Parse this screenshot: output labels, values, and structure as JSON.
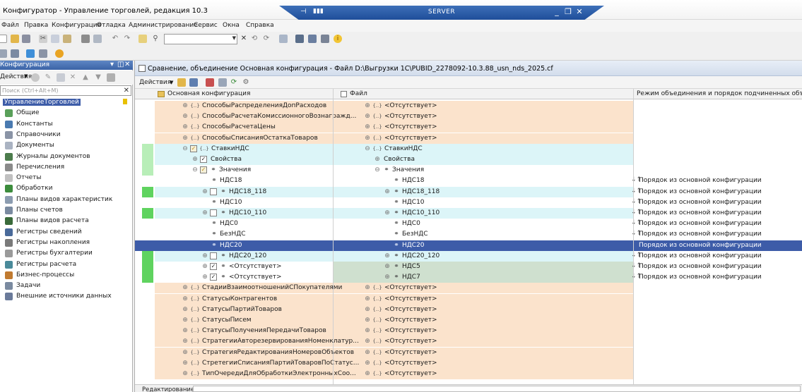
{
  "window": {
    "title": "Конфигуратор - Управление торговлей, редакция 10.3",
    "rdp_label": "SERVER"
  },
  "menu": [
    "Файл",
    "Правка",
    "Конфигурация",
    "Отладка",
    "Администрирование",
    "Сервис",
    "Окна",
    "Справка"
  ],
  "left_panel": {
    "title": "Конфигурация",
    "actions_label": "Действия",
    "search_placeholder": "Поиск (Ctrl+Alt+M)",
    "items": [
      {
        "label": "УправлениеТорговлей",
        "icon": "config-root-icon",
        "selected": true
      },
      {
        "label": "Общие",
        "icon": "common-icon"
      },
      {
        "label": "Константы",
        "icon": "constants-icon"
      },
      {
        "label": "Справочники",
        "icon": "catalogs-icon"
      },
      {
        "label": "Документы",
        "icon": "documents-icon"
      },
      {
        "label": "Журналы документов",
        "icon": "journals-icon"
      },
      {
        "label": "Перечисления",
        "icon": "enums-icon"
      },
      {
        "label": "Отчеты",
        "icon": "reports-icon"
      },
      {
        "label": "Обработки",
        "icon": "processing-icon"
      },
      {
        "label": "Планы видов характеристик",
        "icon": "chart-of-char-icon"
      },
      {
        "label": "Планы счетов",
        "icon": "chart-of-accounts-icon"
      },
      {
        "label": "Планы видов расчета",
        "icon": "chart-of-calc-icon"
      },
      {
        "label": "Регистры сведений",
        "icon": "info-register-icon"
      },
      {
        "label": "Регистры накопления",
        "icon": "accum-register-icon"
      },
      {
        "label": "Регистры бухгалтерии",
        "icon": "acc-register-icon"
      },
      {
        "label": "Регистры расчета",
        "icon": "calc-register-icon"
      },
      {
        "label": "Бизнес-процессы",
        "icon": "business-process-icon"
      },
      {
        "label": "Задачи",
        "icon": "tasks-icon"
      },
      {
        "label": "Внешние источники данных",
        "icon": "external-sources-icon"
      }
    ]
  },
  "compare": {
    "title": "Сравнение, объединение Основная конфигурация - Файл D:\\Выгрузки 1С\\PUBID_2278092-10.3.88_usn_nds_2025.cf",
    "actions_label": "Действия",
    "columns": {
      "main": "Основная конфигурация",
      "file": "Файл",
      "mode": "Режим объединения и порядок подчиненных объектов"
    },
    "status_label": "Редактирование:",
    "colors": {
      "orange_bg": "#fbe3cc",
      "cyan_bg": "#dcf5f8",
      "gray_green_bg": "#cfe0cf",
      "selected_bg": "#3d5ca8",
      "marker_green": "#5fd35f",
      "marker_light": "#b8eeb8"
    },
    "rows": [
      {
        "main_label": "СпособыРаспределенияДопРасходов",
        "main_indent": 1,
        "main_pm": "+",
        "main_icon": "enum",
        "main_cb": "",
        "file_label": "<Отсутствует>",
        "file_indent": 1,
        "file_pm": "+",
        "file_icon": "enum",
        "bg": "orange",
        "marker": "",
        "order": ""
      },
      {
        "main_label": "СпособыРасчетаКомиссионногоВознагражд...",
        "main_indent": 1,
        "main_pm": "+",
        "main_icon": "enum",
        "main_cb": "",
        "file_label": "<Отсутствует>",
        "file_indent": 1,
        "file_pm": "+",
        "file_icon": "enum",
        "bg": "orange",
        "marker": "",
        "order": ""
      },
      {
        "main_label": "СпособыРасчетаЦены",
        "main_indent": 1,
        "main_pm": "+",
        "main_icon": "enum",
        "main_cb": "",
        "file_label": "<Отсутствует>",
        "file_indent": 1,
        "file_pm": "+",
        "file_icon": "enum",
        "bg": "orange",
        "marker": "",
        "order": ""
      },
      {
        "main_label": "СпособыСписанияОстаткаТоваров",
        "main_indent": 1,
        "main_pm": "+",
        "main_icon": "enum",
        "main_cb": "",
        "file_label": "<Отсутствует>",
        "file_indent": 1,
        "file_pm": "+",
        "file_icon": "enum",
        "bg": "orange",
        "marker": "",
        "order": ""
      },
      {
        "main_label": "СтавкиНДС",
        "main_indent": 1,
        "main_pm": "-",
        "main_icon": "enum",
        "main_cb": "partial",
        "file_label": "СтавкиНДС",
        "file_indent": 1,
        "file_pm": "-",
        "file_icon": "enum",
        "bg": "cyan",
        "marker": "light",
        "order": ""
      },
      {
        "main_label": "Свойства",
        "main_indent": 2,
        "main_pm": "+",
        "main_icon": "",
        "main_cb": "checked",
        "file_label": "Свойства",
        "file_indent": 2,
        "file_pm": "+",
        "file_icon": "",
        "bg": "cyan",
        "marker": "light",
        "order": ""
      },
      {
        "main_label": "Значения",
        "main_indent": 2,
        "main_pm": "-",
        "main_icon": "value",
        "main_cb": "partial",
        "file_label": "Значения",
        "file_indent": 2,
        "file_pm": "-",
        "file_icon": "value",
        "bg": "white",
        "marker": "light",
        "order": ""
      },
      {
        "main_label": "НДС18",
        "main_indent": 3,
        "main_pm": "",
        "main_icon": "value",
        "main_cb": "",
        "file_label": "НДС18",
        "file_indent": 3,
        "file_pm": "",
        "file_icon": "value",
        "bg": "white",
        "marker": "",
        "order": "Порядок из основной конфигурации"
      },
      {
        "main_label": "НДС18_118",
        "main_indent": 3,
        "main_pm": "+",
        "main_icon": "value",
        "main_cb": "empty",
        "file_label": "НДС18_118",
        "file_indent": 3,
        "file_pm": "+",
        "file_icon": "value",
        "bg": "cyan",
        "marker": "green",
        "order": "Порядок из основной конфигурации"
      },
      {
        "main_label": "НДС10",
        "main_indent": 3,
        "main_pm": "",
        "main_icon": "value",
        "main_cb": "",
        "file_label": "НДС10",
        "file_indent": 3,
        "file_pm": "",
        "file_icon": "value",
        "bg": "white",
        "marker": "",
        "order": "Порядок из основной конфигурации"
      },
      {
        "main_label": "НДС10_110",
        "main_indent": 3,
        "main_pm": "+",
        "main_icon": "value",
        "main_cb": "empty",
        "file_label": "НДС10_110",
        "file_indent": 3,
        "file_pm": "+",
        "file_icon": "value",
        "bg": "cyan",
        "marker": "green",
        "order": "Порядок из основной конфигурации"
      },
      {
        "main_label": "НДС0",
        "main_indent": 3,
        "main_pm": "",
        "main_icon": "value",
        "main_cb": "",
        "file_label": "НДС0",
        "file_indent": 3,
        "file_pm": "",
        "file_icon": "value",
        "bg": "white",
        "marker": "",
        "order": "Порядок из основной конфигурации"
      },
      {
        "main_label": "БезНДС",
        "main_indent": 3,
        "main_pm": "",
        "main_icon": "value",
        "main_cb": "",
        "file_label": "БезНДС",
        "file_indent": 3,
        "file_pm": "",
        "file_icon": "value",
        "bg": "white",
        "marker": "",
        "order": "Порядок из основной конфигурации"
      },
      {
        "main_label": "НДС20",
        "main_indent": 3,
        "main_pm": "",
        "main_icon": "value",
        "main_cb": "",
        "file_label": "НДС20",
        "file_indent": 3,
        "file_pm": "",
        "file_icon": "value",
        "bg": "selected",
        "marker": "",
        "order": "Порядок из основной конфигурации"
      },
      {
        "main_label": "НДС20_120",
        "main_indent": 3,
        "main_pm": "+",
        "main_icon": "value",
        "main_cb": "empty",
        "file_label": "НДС20_120",
        "file_indent": 3,
        "file_pm": "+",
        "file_icon": "value",
        "bg": "cyan",
        "marker": "green",
        "order": "Порядок из основной конфигурации"
      },
      {
        "main_label": "<Отсутствует>",
        "main_indent": 3,
        "main_pm": "+",
        "main_icon": "value",
        "main_cb": "checked",
        "file_label": "НДС5",
        "file_indent": 3,
        "file_pm": "+",
        "file_icon": "value",
        "bg": "graygreen",
        "marker": "green",
        "order": "Порядок из основной конфигурации"
      },
      {
        "main_label": "<Отсутствует>",
        "main_indent": 3,
        "main_pm": "+",
        "main_icon": "value",
        "main_cb": "checked",
        "file_label": "НДС7",
        "file_indent": 3,
        "file_pm": "+",
        "file_icon": "value",
        "bg": "graygreen",
        "marker": "green",
        "order": "Порядок из основной конфигурации"
      },
      {
        "main_label": "СтадииВзаимоотношенийСПокупателями",
        "main_indent": 1,
        "main_pm": "+",
        "main_icon": "enum",
        "main_cb": "",
        "file_label": "<Отсутствует>",
        "file_indent": 1,
        "file_pm": "+",
        "file_icon": "enum",
        "bg": "orange",
        "marker": "",
        "order": ""
      },
      {
        "main_label": "СтатусыКонтрагентов",
        "main_indent": 1,
        "main_pm": "+",
        "main_icon": "enum",
        "main_cb": "",
        "file_label": "<Отсутствует>",
        "file_indent": 1,
        "file_pm": "+",
        "file_icon": "enum",
        "bg": "orange",
        "marker": "",
        "order": ""
      },
      {
        "main_label": "СтатусыПартийТоваров",
        "main_indent": 1,
        "main_pm": "+",
        "main_icon": "enum",
        "main_cb": "",
        "file_label": "<Отсутствует>",
        "file_indent": 1,
        "file_pm": "+",
        "file_icon": "enum",
        "bg": "orange",
        "marker": "",
        "order": ""
      },
      {
        "main_label": "СтатусыПисем",
        "main_indent": 1,
        "main_pm": "+",
        "main_icon": "enum",
        "main_cb": "",
        "file_label": "<Отсутствует>",
        "file_indent": 1,
        "file_pm": "+",
        "file_icon": "enum",
        "bg": "orange",
        "marker": "",
        "order": ""
      },
      {
        "main_label": "СтатусыПолученияПередачиТоваров",
        "main_indent": 1,
        "main_pm": "+",
        "main_icon": "enum",
        "main_cb": "",
        "file_label": "<Отсутствует>",
        "file_indent": 1,
        "file_pm": "+",
        "file_icon": "enum",
        "bg": "orange",
        "marker": "",
        "order": ""
      },
      {
        "main_label": "СтратегииАвторезервированияНоменклатур...",
        "main_indent": 1,
        "main_pm": "+",
        "main_icon": "enum",
        "main_cb": "",
        "file_label": "<Отсутствует>",
        "file_indent": 1,
        "file_pm": "+",
        "file_icon": "enum",
        "bg": "orange",
        "marker": "",
        "order": ""
      },
      {
        "main_label": "СтратегияРедактированияНомеровОбъектов",
        "main_indent": 1,
        "main_pm": "+",
        "main_icon": "enum",
        "main_cb": "",
        "file_label": "<Отсутствует>",
        "file_indent": 1,
        "file_pm": "+",
        "file_icon": "enum",
        "bg": "orange",
        "marker": "",
        "order": ""
      },
      {
        "main_label": "СтретегииСписанияПартийТоваровПоСтатус...",
        "main_indent": 1,
        "main_pm": "+",
        "main_icon": "enum",
        "main_cb": "",
        "file_label": "<Отсутствует>",
        "file_indent": 1,
        "file_pm": "+",
        "file_icon": "enum",
        "bg": "orange",
        "marker": "",
        "order": ""
      },
      {
        "main_label": "ТипОчередиДляОбработкиЭлектронныхСоо...",
        "main_indent": 1,
        "main_pm": "+",
        "main_icon": "enum",
        "main_cb": "",
        "file_label": "<Отсутствует>",
        "file_indent": 1,
        "file_pm": "+",
        "file_icon": "enum",
        "bg": "orange",
        "marker": "",
        "order": ""
      }
    ]
  }
}
